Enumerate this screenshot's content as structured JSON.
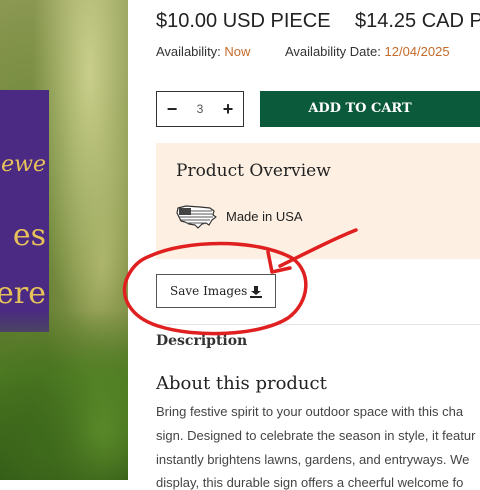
{
  "product": {
    "price_usd": "$10.00 USD PIECE",
    "price_cad": "$14.25 CAD P",
    "availability_label": "Availability:",
    "availability_value": "Now",
    "availability_date_label": "Availability Date:",
    "availability_date_value": "12/04/2025"
  },
  "image": {
    "sign_lines": [
      "ewe",
      "es",
      "ere"
    ]
  },
  "purchase": {
    "minus_label": "−",
    "quantity": "3",
    "plus_label": "+",
    "add_to_cart_label": "ADD TO CART"
  },
  "overview": {
    "title": "Product Overview",
    "made_in": "Made in USA"
  },
  "save_images": {
    "label": "Save Images"
  },
  "tabs": {
    "description": "Description"
  },
  "about": {
    "title": "About this product",
    "lines": [
      "Bring festive spirit to your outdoor space with this cha",
      "sign. Designed to celebrate the season in style, it featur",
      "instantly brightens lawns, gardens, and entryways. We",
      "display, this durable sign offers a cheerful welcome fo"
    ]
  },
  "colors": {
    "brand_green": "#0c5a3c",
    "availability_accent": "#c46b2b",
    "overview_panel_bg": "#fdf0e2",
    "annotation_red": "#e02020",
    "sign_purple": "#4a2a82",
    "sign_gold": "#e7c25a"
  },
  "icons": {
    "quantity_minus": "minus-icon",
    "quantity_plus": "plus-icon",
    "made_in_usa": "usa-map-icon",
    "save_images": "download-icon"
  }
}
